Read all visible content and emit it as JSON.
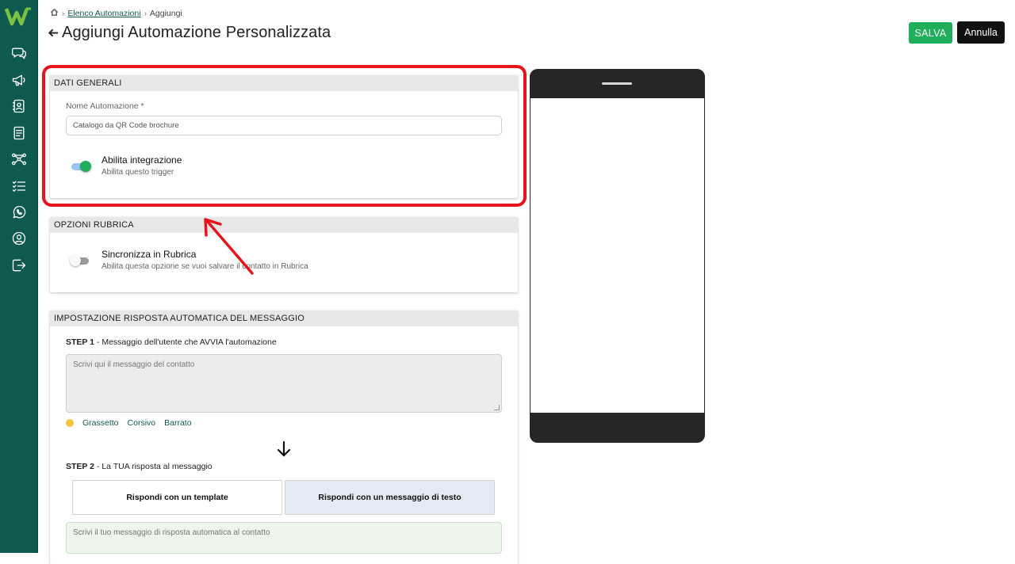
{
  "breadcrumb": {
    "home_icon": "home-icon",
    "link": "Elenco Automazioni",
    "current": "Aggiungi"
  },
  "page": {
    "title": "Aggiungi Automazione Personalizzata"
  },
  "actions": {
    "save": "SALVA",
    "cancel": "Annulla"
  },
  "sidebar": {
    "items": [
      {
        "icon": "chat-bubbles-icon"
      },
      {
        "icon": "megaphone-icon"
      },
      {
        "icon": "contacts-book-icon"
      },
      {
        "icon": "document-icon"
      },
      {
        "icon": "workflow-icon"
      },
      {
        "icon": "checklist-icon"
      },
      {
        "icon": "whatsapp-icon"
      },
      {
        "icon": "user-circle-icon"
      },
      {
        "icon": "logout-icon"
      }
    ]
  },
  "general": {
    "header": "DATI GENERALI",
    "name_label": "Nome Automazione *",
    "name_value": "Catalogo da QR Code brochure",
    "toggle_title": "Abilita integrazione",
    "toggle_sub": "Abilita questo trigger",
    "toggle_on": true
  },
  "rubrica": {
    "header": "OPZIONI RUBRICA",
    "toggle_title": "Sincronizza in Rubrica",
    "toggle_sub": "Abilita questa opzione se vuoi salvare il contatto in Rubrica",
    "toggle_on": false
  },
  "reply": {
    "header": "IMPOSTAZIONE RISPOSTA AUTOMATICA DEL MESSAGGIO",
    "step1_bold": "STEP 1",
    "step1_text": " - Messaggio dell'utente che AVVIA l'automazione",
    "step1_placeholder": "Scrivi qui il messaggio del contatto",
    "format": {
      "bold": "Grassetto",
      "italic": "Corsivo",
      "strike": "Barrato"
    },
    "step2_bold": "STEP 2",
    "step2_text": " - La TUA risposta al messaggio",
    "option_template": "Rispondi con un template",
    "option_text": "Rispondi con un messaggio di testo",
    "reply_placeholder": "Scrivi il tuo messaggio di risposta automatica al contatto"
  },
  "colors": {
    "brand": "#0f5a4f",
    "save": "#1fae5a",
    "annotation": "#e8141b",
    "toggle_on": "#1fae5a"
  }
}
